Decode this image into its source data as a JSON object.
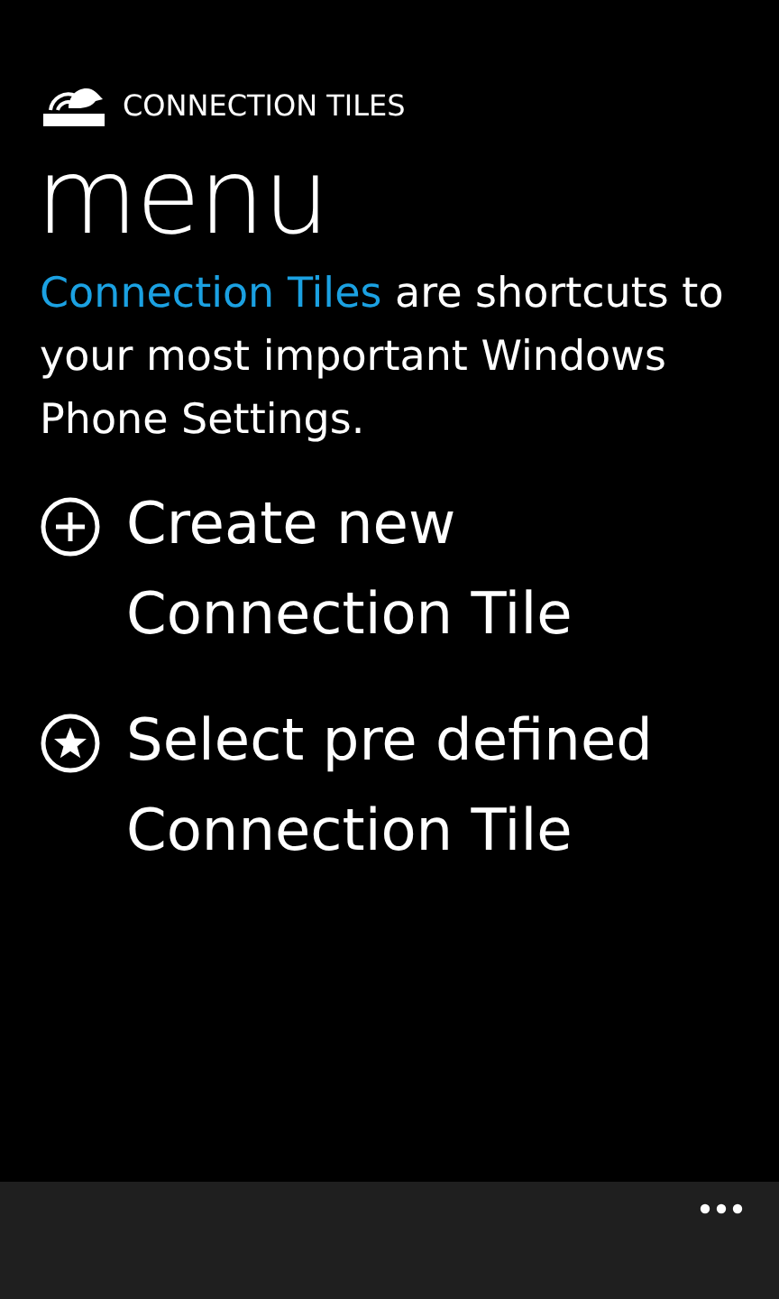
{
  "app_title": "CONNECTION TILES",
  "page_title": "menu",
  "intro": {
    "link": "Connection Tiles",
    "text": " are shortcuts to your most important Windows Phone Settings."
  },
  "items": [
    {
      "kind": "add",
      "label": "Create new Connection Tile"
    },
    {
      "kind": "star",
      "label": "Select pre defined Connection Tile"
    }
  ]
}
